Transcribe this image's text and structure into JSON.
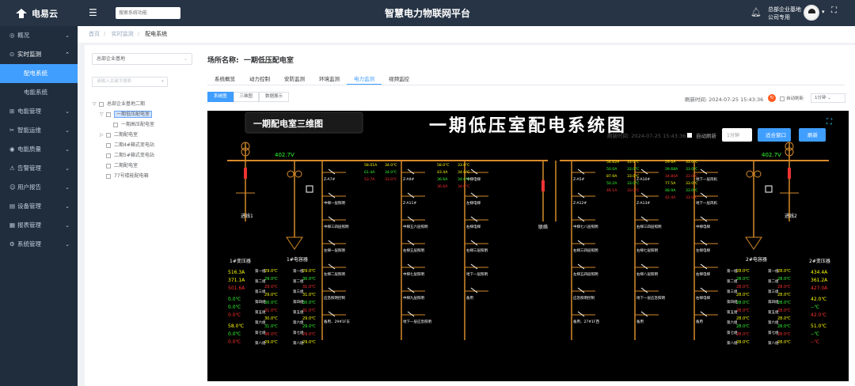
{
  "app": {
    "logo": "电易云",
    "title": "智慧电力物联网平台",
    "search_placeholder": "搜索系统功能",
    "user_line1": "总部企业基地",
    "user_line2": "公司专用"
  },
  "sidebar": {
    "items": [
      {
        "label": "概况",
        "icon": "◎",
        "expandable": true
      },
      {
        "label": "实时监测",
        "icon": "⊙",
        "expandable": true,
        "open": true,
        "children": [
          {
            "label": "配电系统",
            "active": true
          },
          {
            "label": "电能系统",
            "active": false
          }
        ]
      },
      {
        "label": "电能管理",
        "icon": "⊞",
        "expandable": true
      },
      {
        "label": "智能运维",
        "icon": "✂",
        "expandable": true
      },
      {
        "label": "电能质量",
        "icon": "◉",
        "expandable": true
      },
      {
        "label": "告警管理",
        "icon": "⚠",
        "expandable": true
      },
      {
        "label": "用户报告",
        "icon": "☺",
        "expandable": true
      },
      {
        "label": "设备管理",
        "icon": "▤",
        "expandable": true
      },
      {
        "label": "报表管理",
        "icon": "▦",
        "expandable": true
      },
      {
        "label": "系统管理",
        "icon": "⚙",
        "expandable": true
      }
    ]
  },
  "breadcrumb": [
    "首页",
    "实时监测",
    "配电系统"
  ],
  "left": {
    "select": "总部企业基地",
    "search_placeholder": "请输入关键字搜索",
    "tree": [
      {
        "label": "总部企业基地二期",
        "level": 0,
        "exp": "▽"
      },
      {
        "label": "一期低压配电室",
        "level": 1,
        "exp": "▽",
        "selected": true
      },
      {
        "label": "一期高压配电室",
        "level": 2,
        "exp": ""
      },
      {
        "label": "二期配电室",
        "level": 1,
        "exp": "▷"
      },
      {
        "label": "二期4#箱式变电站",
        "level": 1,
        "exp": ""
      },
      {
        "label": "二期5#箱式变电站",
        "level": 1,
        "exp": ""
      },
      {
        "label": "二期配电室",
        "level": 1,
        "exp": ""
      },
      {
        "label": "77号楼能配电箱",
        "level": 1,
        "exp": ""
      }
    ]
  },
  "main": {
    "site_label": "场所名称:",
    "site_name": "一期低压配电室",
    "tabs": [
      "系统概览",
      "动力控制",
      "安防监测",
      "环境监测",
      "电力监测",
      "视频监控"
    ],
    "active_tab": 4,
    "views": [
      "系统图",
      "三维图",
      "数据展示"
    ],
    "active_view": 0,
    "refresh_time": "刷新时间: 2024-07-25 15:43:36",
    "auto_refresh": "自动刷新",
    "interval": "1分钟"
  },
  "diagram": {
    "title": "一期低压室配电系统图",
    "btn3d": "一期配电室三维图",
    "refresh_time": "刷新时间: 2024-07-25 15:43:36",
    "auto": "自动刷新",
    "interval": "1分钟",
    "btn_fit": "适合窗口",
    "btn_refresh": "刷新",
    "bus_left": "402.7V",
    "bus_right": "402.7V",
    "in1": "进线1",
    "in2": "进线2",
    "tie": "联络",
    "tr1": "1#变压器",
    "tr2": "2#变压器",
    "fan1": "1#电容器",
    "fan2": "2#电容器",
    "left_meas": [
      {
        "v": "516.3A",
        "c": "#ffff00"
      },
      {
        "v": "371.1A",
        "c": "#ffff00"
      },
      {
        "v": "501.6A",
        "c": "#ff3030"
      },
      {
        "v": "0.0℃",
        "c": "#33ff33"
      },
      {
        "v": "0.0℃",
        "c": "#33ff33"
      },
      {
        "v": "0.0℃",
        "c": "#ff3030"
      },
      {
        "v": "58.0℃",
        "c": "#ffff00"
      },
      {
        "v": "0.0℃",
        "c": "#33ff33"
      },
      {
        "v": "0.0℃",
        "c": "#ff3030"
      }
    ],
    "right_meas": [
      {
        "v": "434.4A",
        "c": "#ffff00"
      },
      {
        "v": "361.2A",
        "c": "#ffff00"
      },
      {
        "v": "427.0A",
        "c": "#ff3030"
      },
      {
        "v": "42.0℃",
        "c": "#ffff00"
      },
      {
        "v": "--℃",
        "c": "#33ff33"
      },
      {
        "v": "42.0℃",
        "c": "#ff3030"
      },
      {
        "v": "51.0℃",
        "c": "#ffff00"
      },
      {
        "v": "--℃",
        "c": "#33ff33"
      },
      {
        "v": "--℃",
        "c": "#ff3030"
      }
    ],
    "temps_l1": [
      "29.0℃",
      "29.0℃",
      "29.0℃",
      "29.0℃",
      "30.0℃",
      "31.0℃",
      "30.0℃",
      "31.0℃",
      "38.0℃",
      "29.0℃"
    ],
    "temps_l2": [
      "29.0℃",
      "30.0℃",
      "31.0℃",
      "31.0℃",
      "30.0℃",
      "31.0℃",
      "29.0℃",
      "29.0℃",
      "29.0℃",
      "29.0℃"
    ],
    "temps_r1": [
      "28.0℃",
      "28.0℃",
      "28.0℃",
      "28.0℃",
      "28.0℃",
      "28.0℃",
      "28.0℃",
      "28.0℃",
      "28.0℃",
      "28.0℃"
    ],
    "temps_r2": [
      "28.0℃",
      "28.0℃",
      "28.0℃",
      "28.0℃",
      "28.0℃",
      "28.0℃",
      "28.0℃",
      "28.0℃",
      "28.0℃",
      "28.0℃"
    ],
    "feeder_labels_a": [
      "Z-A7#",
      "中梯一层照明",
      "中梯三四层照明",
      "左梯一层照明",
      "左梯二层照明",
      "应急照明控制",
      "备用、29#1F东"
    ],
    "feeder_labels_b": [
      "Z-A9#",
      "Z-A11#",
      "中梯五六层照明",
      "右梯五层照明",
      "中梯七层照明",
      "中梯九层照明",
      "地下一层应急照明"
    ],
    "feeder_labels_c": [
      "中梯电梯",
      "左梯电梯",
      "右梯电梯",
      "右梯三层照明",
      "地下一层照明",
      "备用"
    ],
    "feeder_labels_d": [
      "Z-A5#",
      "Z-A12#",
      "中梯七八层照明",
      "右梯三四层照明",
      "左梯五四层照明",
      "应急照明控制",
      "备用、27#1F西"
    ],
    "feeder_labels_e": [
      "Z-A10#",
      "Z-A13#",
      "右梯三四层照明",
      "右梯七层照明",
      "右梯八层照明",
      "地下一层应急照明",
      "备用"
    ],
    "feeder_labels_f": [
      "地下一层风机",
      "地下一层风机",
      "中梯电梯",
      "左梯电梯",
      "右梯电梯",
      "右梯电梯",
      "备用"
    ],
    "meas_a": [
      {
        "v": "58.01A",
        "c": "#ffff00"
      },
      {
        "v": "34.0℃",
        "c": "#ffff00"
      },
      {
        "v": "61.4A",
        "c": "#33ff33"
      },
      {
        "v": "34.0℃",
        "c": "#33ff33"
      },
      {
        "v": "53.7A",
        "c": "#ff3030"
      },
      {
        "v": "33.0℃",
        "c": "#ff3030"
      }
    ],
    "meas_b": [
      {
        "v": "58.0℃",
        "c": "#ffff00"
      },
      {
        "v": "33.0℃",
        "c": "#ffff00"
      },
      {
        "v": "43.4A",
        "c": "#ffff00"
      },
      {
        "v": "34.0℃",
        "c": "#ffff00"
      },
      {
        "v": "36.6A",
        "c": "#33ff33"
      },
      {
        "v": "34.0℃",
        "c": "#33ff33"
      },
      {
        "v": "36.6A",
        "c": "#ff3030"
      },
      {
        "v": "34.0℃",
        "c": "#ff3030"
      }
    ],
    "meas_d": [
      {
        "v": "54.62A",
        "c": "#ffff00"
      },
      {
        "v": "33.0℃",
        "c": "#ffff00"
      },
      {
        "v": "50.0A",
        "c": "#33ff33"
      },
      {
        "v": "33.0℃",
        "c": "#33ff33"
      },
      {
        "v": "87.9A",
        "c": "#ffff00"
      },
      {
        "v": "33.0℃",
        "c": "#ffff00"
      },
      {
        "v": "50.2A",
        "c": "#33ff33"
      },
      {
        "v": "33.0℃",
        "c": "#33ff33"
      },
      {
        "v": "46.1A",
        "c": "#ff3030"
      },
      {
        "v": "33.0℃",
        "c": "#ff3030"
      }
    ],
    "meas_e": [
      {
        "v": "29.6A",
        "c": "#ffff00"
      },
      {
        "v": "33.0℃",
        "c": "#ffff00"
      },
      {
        "v": "39.68A",
        "c": "#33ff33"
      },
      {
        "v": "33.0℃",
        "c": "#33ff33"
      },
      {
        "v": "34.80A",
        "c": "#ff3030"
      },
      {
        "v": "33.0℃",
        "c": "#ff3030"
      },
      {
        "v": "77.5A",
        "c": "#ffff00"
      },
      {
        "v": "33.0℃",
        "c": "#ffff00"
      },
      {
        "v": "48.9A",
        "c": "#33ff33"
      },
      {
        "v": "33.0℃",
        "c": "#33ff33"
      },
      {
        "v": "42.4A",
        "c": "#ff3030"
      },
      {
        "v": "33.0℃",
        "c": "#ff3030"
      }
    ],
    "row_labels": [
      "第一组",
      "第二组",
      "第三组",
      "第四组",
      "第五组",
      "第六组",
      "第七组",
      "第八组"
    ]
  }
}
